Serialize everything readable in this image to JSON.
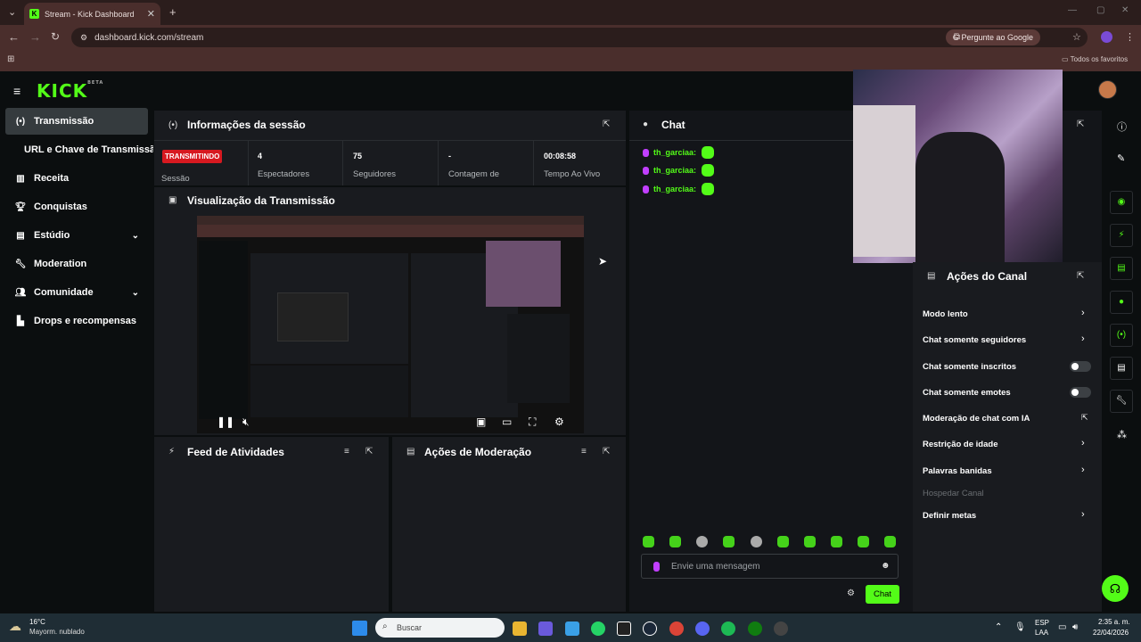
{
  "browser": {
    "tab_title": "Stream - Kick Dashboard",
    "url": "dashboard.kick.com/stream",
    "ask_google": "Pergunte ao Google",
    "bookmarks_label": "Todos os favoritos"
  },
  "sidebar": {
    "logo": "KICK",
    "logo_badge": "BETA",
    "items": [
      {
        "label": "Transmissão",
        "icon": "broadcast-icon"
      },
      {
        "label": "URL e Chave de Transmissão",
        "icon": ""
      },
      {
        "label": "Receita",
        "icon": "chart-icon"
      },
      {
        "label": "Conquistas",
        "icon": "trophy-icon"
      },
      {
        "label": "Estúdio",
        "icon": "studio-icon"
      },
      {
        "label": "Moderation",
        "icon": "wrench-icon"
      },
      {
        "label": "Comunidade",
        "icon": "people-icon"
      },
      {
        "label": "Drops e recompensas",
        "icon": "drops-icon"
      }
    ]
  },
  "session": {
    "title": "Informações da sessão",
    "status": "TRANSMITINDO",
    "status_label": "Sessão",
    "stats": [
      {
        "value": "4",
        "label": "Espectadores"
      },
      {
        "value": "75",
        "label": "Seguidores"
      },
      {
        "value": "-",
        "label": "Contagem de"
      },
      {
        "value": "00:08:58",
        "label": "Tempo Ao Vivo"
      }
    ]
  },
  "preview": {
    "title": "Visualização da Transmissão"
  },
  "activity": {
    "title": "Feed de Atividades"
  },
  "moderation": {
    "title": "Ações de Moderação"
  },
  "chat": {
    "title": "Chat",
    "messages": [
      {
        "user": "th_garciaa:"
      },
      {
        "user": "th_garciaa:"
      },
      {
        "user": "th_garciaa:"
      }
    ],
    "input_placeholder": "Envie uma mensagem",
    "send_label": "Chat"
  },
  "channel_actions": {
    "title": "Ações do Canal",
    "items": [
      {
        "label": "Modo lento",
        "control": "chevron"
      },
      {
        "label": "Chat somente seguidores",
        "control": "chevron"
      },
      {
        "label": "Chat somente inscritos",
        "control": "toggle"
      },
      {
        "label": "Chat somente emotes",
        "control": "toggle"
      },
      {
        "label": "Moderação de chat com IA",
        "control": "external"
      },
      {
        "label": "Restrição de idade",
        "control": "chevron"
      },
      {
        "label": "Palavras banidas",
        "control": "chevron"
      },
      {
        "label": "Hospedar Canal",
        "control": "disabled"
      },
      {
        "label": "Definir metas",
        "control": "chevron"
      }
    ]
  },
  "taskbar": {
    "weather_temp": "16°C",
    "weather_desc": "Mayorm. nublado",
    "search_placeholder": "Buscar",
    "lang": "ESP",
    "lang2": "LAA",
    "time": "2:35 a. m.",
    "date": "22/04/2026"
  },
  "colors": {
    "brand": "#53fc18",
    "live": "#d71920"
  }
}
